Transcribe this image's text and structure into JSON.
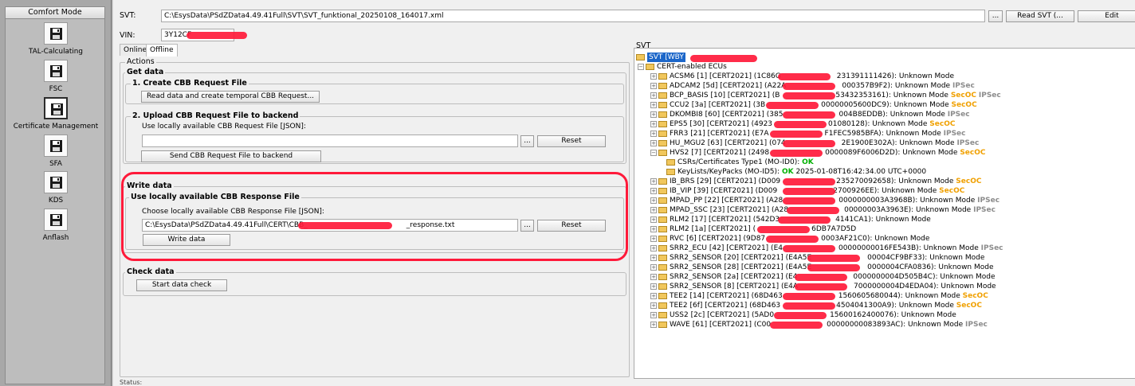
{
  "sidebar": {
    "header": "Comfort Mode",
    "items": [
      {
        "label": "TAL-Calculating",
        "icon": "floppy-disk-icon"
      },
      {
        "label": "FSC",
        "icon": "floppy-disk-icon"
      },
      {
        "label": "Certificate Management",
        "icon": "floppy-disk-icon",
        "active": true
      },
      {
        "label": "SFA",
        "icon": "floppy-disk-icon"
      },
      {
        "label": "KDS",
        "icon": "floppy-disk-icon"
      },
      {
        "label": "Anflash",
        "icon": "floppy-disk-icon"
      }
    ]
  },
  "header": {
    "svt_label": "SVT:",
    "svt_path": "C:\\EsysData\\PSdZData4.49.41Full\\SVT\\SVT_funktional_20250108_164017.xml",
    "browse_label": "...",
    "read_svt_label": "Read SVT (...",
    "edit_label": "Edit",
    "vin_label": "VIN:",
    "vin_value": "3Y12CF"
  },
  "tabs": [
    {
      "label": "Online"
    },
    {
      "label": "Offline"
    }
  ],
  "actions": {
    "title": "Actions",
    "get_data": {
      "title": "Get data",
      "create_title": "1. Create CBB Request File",
      "create_button": "Read data and create temporal CBB Request...",
      "upload_title": "2. Upload CBB Request File to backend",
      "upload_hint": "Use locally available CBB Request File [JSON]:",
      "upload_value": "",
      "browse_label": "...",
      "reset_label": "Reset",
      "send_button": "Send CBB Request File to backend"
    },
    "write_data": {
      "title": "Write data",
      "response_title": "Use locally available CBB Response File",
      "choose_hint": "Choose locally available CBB Response File [JSON]:",
      "file_prefix": "C:\\EsysData\\PSdZData4.49.41Full\\CERT\\CBB_",
      "file_suffix": "_response.txt",
      "browse_label": "...",
      "reset_label": "Reset",
      "write_button": "Write data"
    },
    "check_data": {
      "title": "Check data",
      "check_button": "Start data check"
    }
  },
  "svt_tree": {
    "title": "SVT",
    "root": "SVT [WBY",
    "group": "CERT-enabled ECUs",
    "nodes": [
      {
        "name": "ACSM6 [1] [CERT2021] (1C86G",
        "tail": "231391111426): Unknown Mode",
        "tags": []
      },
      {
        "name": "ADCAM2 [5d] [CERT2021] (A22A",
        "tail": "000357B9F2): Unknown Mode",
        "tags": [
          "IPSec"
        ]
      },
      {
        "name": "BCP_BASIS [10] [CERT2021] (B",
        "tail": "53432353161): Unknown Mode",
        "tags": [
          "SecOC",
          "IPSec"
        ]
      },
      {
        "name": "CCU2 [3a] [CERT2021] (3B",
        "tail": "00000005600DC9): Unknown Mode",
        "tags": [
          "SecOC"
        ]
      },
      {
        "name": "DKOMBI8 [60] [CERT2021] (385",
        "tail": "004B8EDDB): Unknown Mode",
        "tags": [
          "IPSec"
        ]
      },
      {
        "name": "EPS5 [30] [CERT2021] (4923",
        "tail": "01080128): Unknown Mode",
        "tags": [
          "SecOC"
        ]
      },
      {
        "name": "FRR3 [21] [CERT2021] (E7A",
        "tail": "F1FEC5985BFA): Unknown Mode",
        "tags": [
          "IPSec"
        ]
      },
      {
        "name": "HU_MGU2 [63] [CERT2021] (074",
        "tail": "2E1900E302A): Unknown Mode",
        "tags": [
          "IPSec"
        ]
      },
      {
        "name": "HVS2 [7] [CERT2021] (2498",
        "tail": "0000089F6006D2D): Unknown Mode",
        "tags": [
          "SecOC"
        ],
        "expanded": true,
        "children": [
          {
            "text": "CSRs/Certificates Type1 (MO-ID0):",
            "ok": "OK",
            "extra": ""
          },
          {
            "text": "KeyLists/KeyPacks (MO-ID5):",
            "ok": "OK",
            "extra": "2025-01-08T16:42:34.00 UTC+0000"
          }
        ]
      },
      {
        "name": "IB_BRS [29] [CERT2021] (D009",
        "tail": "235270092658): Unknown Mode",
        "tags": [
          "SecOC"
        ]
      },
      {
        "name": "IB_VIP [39] [CERT2021] (D009",
        "tail": "2700926EE): Unknown Mode",
        "tags": [
          "SecOC"
        ]
      },
      {
        "name": "MPAD_PP [22] [CERT2021] (A28",
        "tail": "0000000003A3968B): Unknown Mode",
        "tags": [
          "IPSec"
        ]
      },
      {
        "name": "MPAD_SSC [23] [CERT2021] (A28",
        "tail": "00000003A3963E): Unknown Mode",
        "tags": [
          "IPSec"
        ]
      },
      {
        "name": "RLM2 [17] [CERT2021] (542D3",
        "tail": "4141CA1): Unknown Mode",
        "tags": []
      },
      {
        "name": "RLM2 [1a] [CERT2021] (",
        "tail": "6DB7A7D5D",
        "tags": []
      },
      {
        "name": "RVC [6] [CERT2021] (9D87",
        "tail": "0003AF21C0): Unknown Mode",
        "tags": []
      },
      {
        "name": "SRR2_ECU [42] [CERT2021] (E4",
        "tail": "00000000016FE543B): Unknown Mode",
        "tags": [
          "IPSec"
        ]
      },
      {
        "name": "SRR2_SENSOR [20] [CERT2021] (E4A5E",
        "tail": "00004CF9BF33): Unknown Mode",
        "tags": []
      },
      {
        "name": "SRR2_SENSOR [28] [CERT2021] (E4A5E",
        "tail": "0000004CFA0836): Unknown Mode",
        "tags": []
      },
      {
        "name": "SRR2_SENSOR [2a] [CERT2021] (E4",
        "tail": "0000000004D505B4C): Unknown Mode",
        "tags": []
      },
      {
        "name": "SRR2_SENSOR [8] [CERT2021] (E4A",
        "tail": "7000000004D4EDA04): Unknown Mode",
        "tags": []
      },
      {
        "name": "TEE2 [14] [CERT2021] (68D463",
        "tail": "1560605680044): Unknown Mode",
        "tags": [
          "SecOC"
        ]
      },
      {
        "name": "TEE2 [6f] [CERT2021] (68D463",
        "tail": "4504041300A9): Unknown Mode",
        "tags": [
          "SecOC"
        ]
      },
      {
        "name": "USS2 [2c] [CERT2021] (5AD0",
        "tail": "15600162400076): Unknown Mode",
        "tags": []
      },
      {
        "name": "WAVE [61] [CERT2021] (C00",
        "tail": "00000000083893AC): Unknown Mode",
        "tags": [
          "IPSec"
        ]
      }
    ]
  },
  "status": {
    "label": "Status:"
  },
  "colors": {
    "accent_red": "#ff1a3a",
    "secoc": "#f0a000",
    "ipsec": "#8c8c8c",
    "ok": "#00b000",
    "selection": "#1b66c9"
  }
}
